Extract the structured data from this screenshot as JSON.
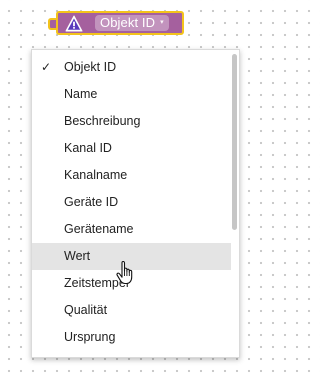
{
  "block": {
    "field_value": "Objekt ID",
    "field_arrow": "▾",
    "color": "#a5609e",
    "outline_color": "#f3c31b",
    "icon": "warning-triangle-icon"
  },
  "menu": {
    "items": [
      {
        "label": "Objekt ID",
        "selected": true
      },
      {
        "label": "Name"
      },
      {
        "label": "Beschreibung"
      },
      {
        "label": "Kanal ID"
      },
      {
        "label": "Kanalname"
      },
      {
        "label": "Geräte ID"
      },
      {
        "label": "Gerätename"
      },
      {
        "label": "Wert",
        "highlighted": true
      },
      {
        "label": "Zeitstempel"
      },
      {
        "label": "Qualität"
      },
      {
        "label": "Ursprung"
      }
    ],
    "check_glyph": "✓",
    "highlight_color": "#e4e4e4"
  },
  "cursor": {
    "icon": "hand-pointer-icon"
  }
}
